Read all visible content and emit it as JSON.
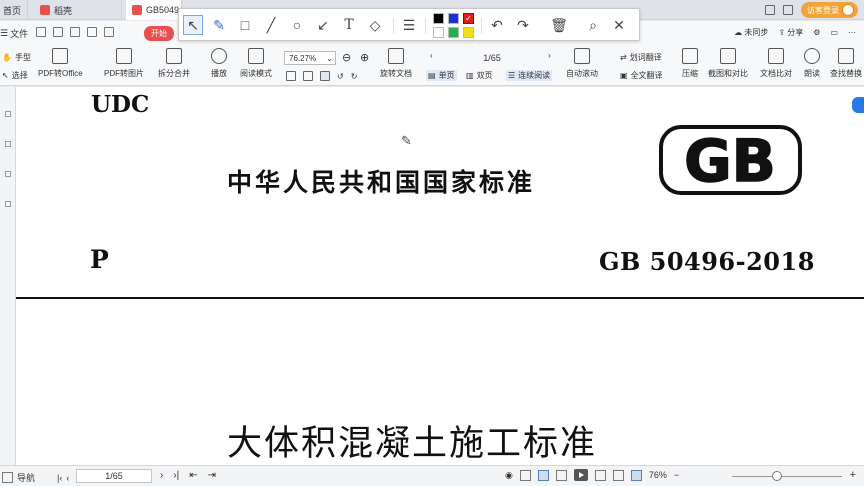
{
  "tabs": [
    {
      "label": "首页"
    },
    {
      "label": "稻壳"
    },
    {
      "label": "GB5049"
    }
  ],
  "topbar": {
    "login_label": "访客登录",
    "sync_label": "未同步",
    "share_label": "分享"
  },
  "quick": {
    "file_label": "文件",
    "start_label": "开始"
  },
  "annotation_toolbar": {
    "colors": [
      "#000000",
      "#1f2fd6",
      "#e02020",
      "#ffffff",
      "#22b14c",
      "#f2e01a"
    ],
    "selected_color": "#e02020"
  },
  "ribbon": {
    "hand_label": "手型",
    "select_label": "选择",
    "pdf_office": "PDF转Office",
    "pdf_image": "PDF转图片",
    "split_merge": "拆分合并",
    "play": "播放",
    "read_mode": "阅读模式",
    "zoom": "76.27%",
    "rotate_doc": "旋转文档",
    "page_indicator": "1/65",
    "single_page": "单页",
    "double_page": "双页",
    "continuous": "连续阅读",
    "auto_scroll": "自动滚动",
    "translate_sel": "划词翻译",
    "translate_full": "全文翻译",
    "compress": "压缩",
    "crop_compare": "截图和对比",
    "doc_compare": "文档比对",
    "read_aloud": "朗读",
    "find_replace": "查找替换"
  },
  "document": {
    "udc": "UDC",
    "national_standard": "中华人民共和国国家标准",
    "p_letter": "P",
    "standard_code": "GB 50496-2018",
    "logo_text": "GB",
    "title": "大体积混凝土施工标准"
  },
  "statusbar": {
    "nav_label": "导航",
    "page": "1/65",
    "zoom": "76%"
  }
}
